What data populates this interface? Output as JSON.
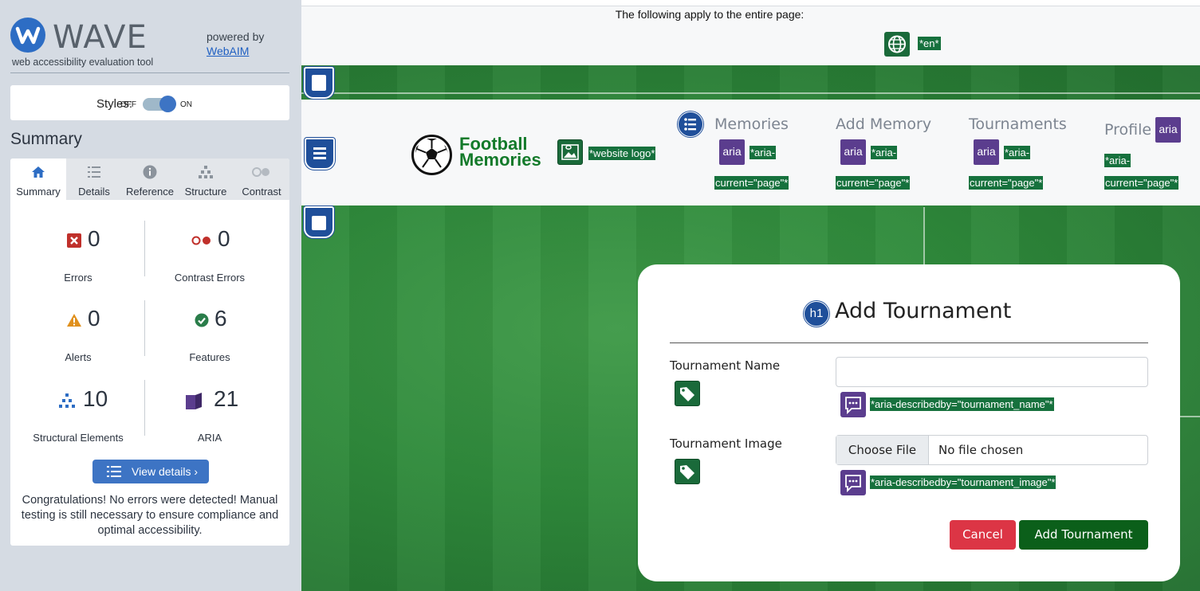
{
  "wave": {
    "brand": "WAVE",
    "subtitle": "web accessibility evaluation tool",
    "powered_by": "powered by",
    "webaim_link": "WebAIM",
    "styles_label": "Styles:",
    "styles_off": "OFF",
    "styles_on": "ON",
    "styles_enabled": true,
    "summary_heading": "Summary",
    "tabs": [
      {
        "label": "Summary",
        "icon": "home-icon",
        "active": true
      },
      {
        "label": "Details",
        "icon": "list-icon",
        "active": false
      },
      {
        "label": "Reference",
        "icon": "info-icon",
        "active": false
      },
      {
        "label": "Structure",
        "icon": "hierarchy-icon",
        "active": false
      },
      {
        "label": "Contrast",
        "icon": "contrast-icon",
        "active": false
      }
    ],
    "stats": {
      "errors": {
        "value": "0",
        "label": "Errors",
        "icon": "error-icon",
        "color": "#c0302b"
      },
      "contrast_errors": {
        "value": "0",
        "label": "Contrast Errors",
        "icon": "contrast-error-icon",
        "color": "#c0302b"
      },
      "alerts": {
        "value": "0",
        "label": "Alerts",
        "icon": "alert-icon",
        "color": "#e0901d"
      },
      "features": {
        "value": "6",
        "label": "Features",
        "icon": "feature-icon",
        "color": "#2a7d4a"
      },
      "structural": {
        "value": "10",
        "label": "Structural Elements",
        "icon": "structure-icon",
        "color": "#2d6dc4"
      },
      "aria": {
        "value": "21",
        "label": "ARIA",
        "icon": "aria-icon",
        "color": "#5b3d8e"
      }
    },
    "view_details": "View details ›",
    "congrats": "Congratulations! No errors were detected! Manual testing is still necessary to ensure compliance and optimal accessibility."
  },
  "page": {
    "applies_text": "The following apply to the entire page:",
    "lang_tag": "*en*",
    "logo_line1": "Football",
    "logo_line2": "Memories",
    "logo_tag": "*website logo*",
    "nav": [
      {
        "label": "Memories",
        "aria_tag_1": "*aria-",
        "aria_tag_2": "current=\"page\"*"
      },
      {
        "label": "Add Memory",
        "aria_tag_1": "*aria-",
        "aria_tag_2": "current=\"page\"*"
      },
      {
        "label": "Tournaments",
        "aria_tag_1": "*aria-",
        "aria_tag_2": "current=\"page\"*"
      },
      {
        "label": "Profile",
        "aria_tag_1": "*aria-",
        "aria_tag_2": "current=\"page\"*"
      }
    ],
    "aria_icon_text": "aria",
    "h1_icon_text": "h1",
    "form": {
      "title": "Add Tournament",
      "name_label": "Tournament Name",
      "name_value": "",
      "name_describedby": "*aria-describedby=\"tournament_name\"*",
      "image_label": "Tournament Image",
      "choose_file": "Choose File",
      "file_status": "No file chosen",
      "image_describedby": "*aria-describedby=\"tournament_image\"*",
      "cancel": "Cancel",
      "submit": "Add Tournament"
    }
  },
  "colors": {
    "accent_blue": "#3d74c4",
    "wave_green": "#16713d",
    "aria_purple": "#5b3d8e",
    "cancel_red": "#dc3545",
    "submit_green": "#0b5f1a"
  }
}
